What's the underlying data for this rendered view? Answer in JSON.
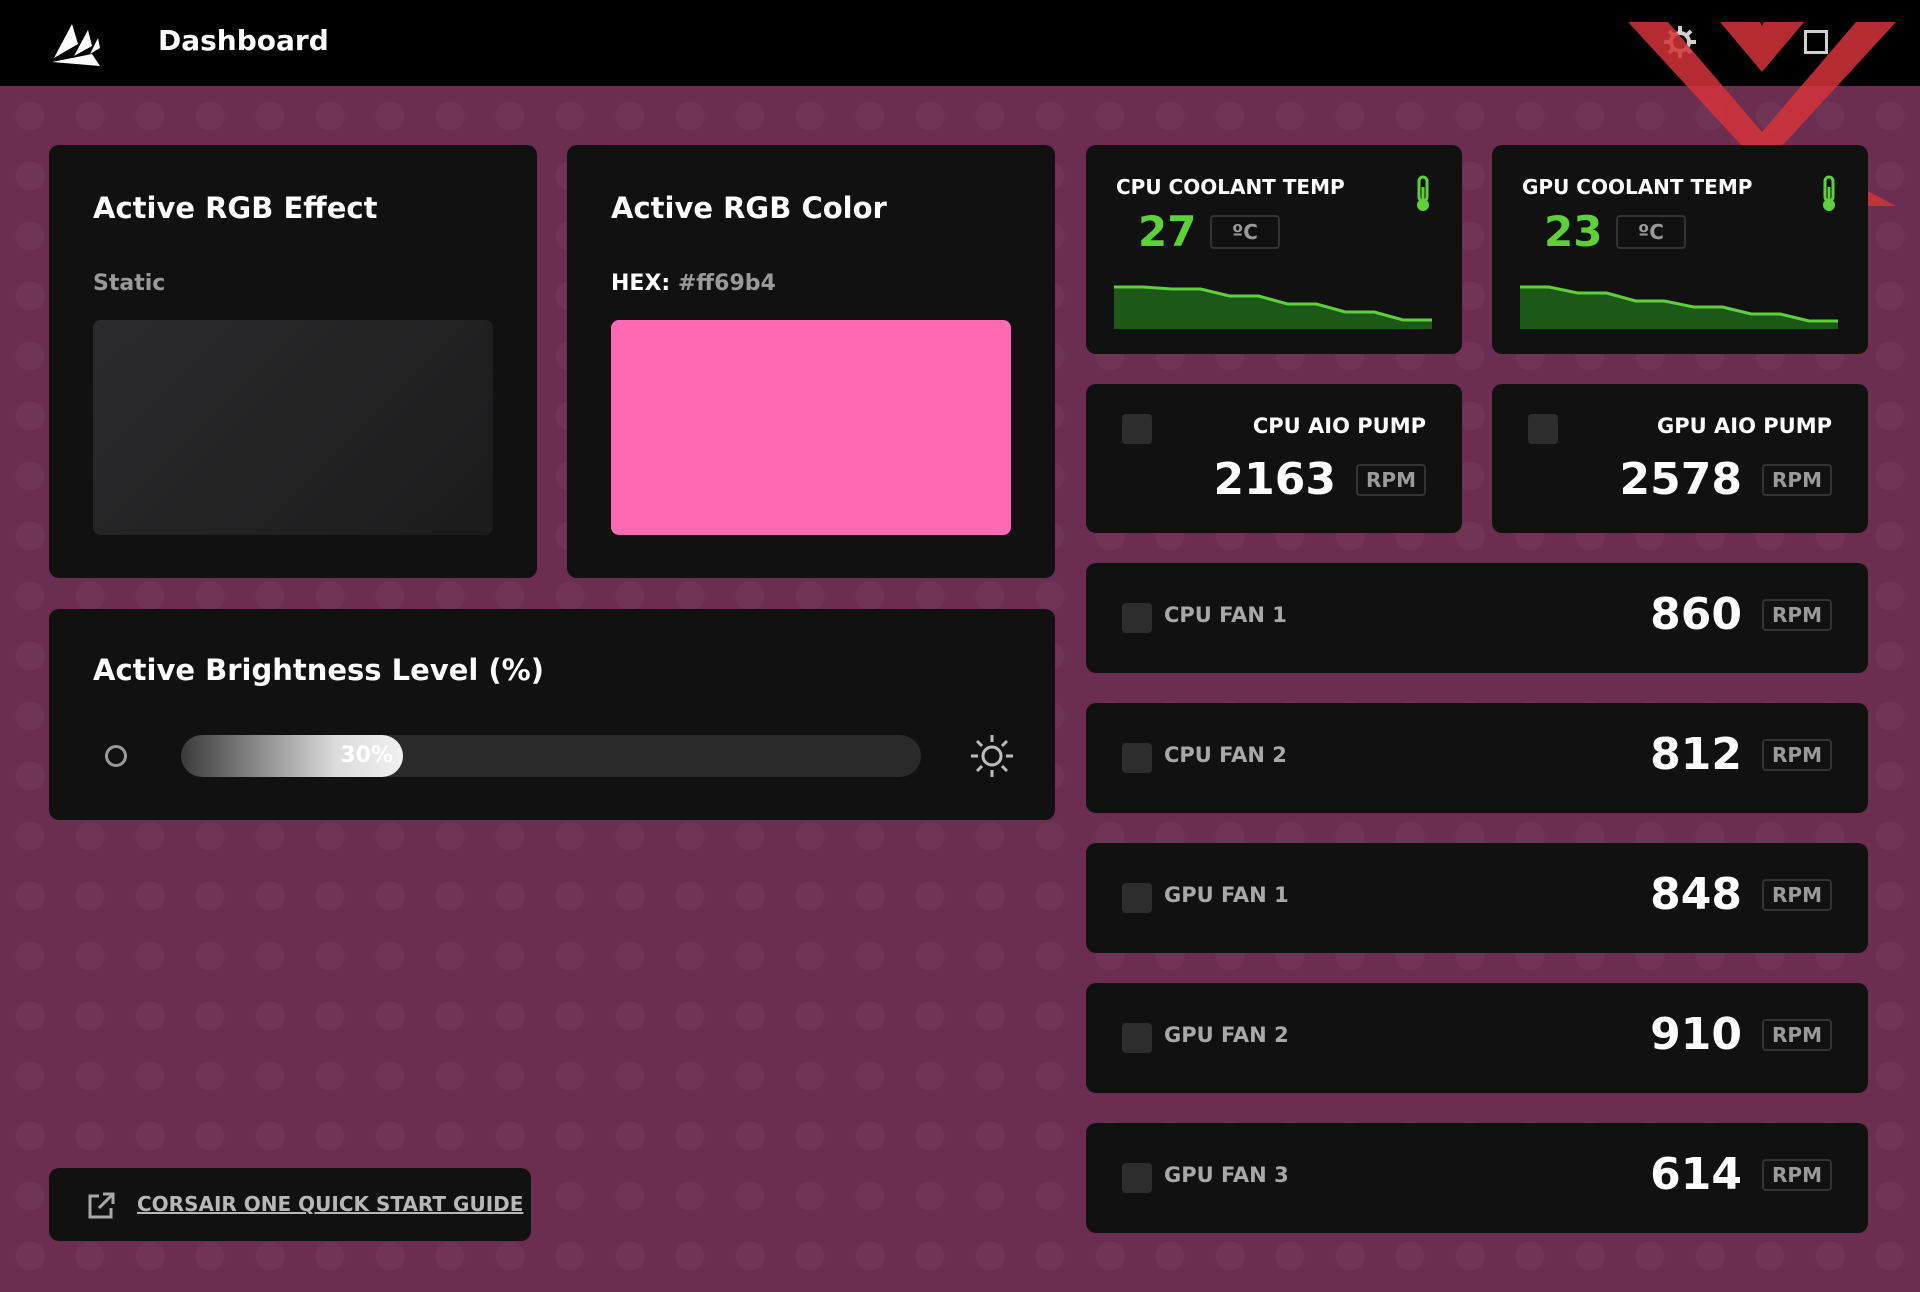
{
  "window": {
    "title": "Dashboard",
    "logo": "corsair-sails-logo",
    "icons": [
      "gear-icon",
      "maximize-icon"
    ]
  },
  "rgb_effect": {
    "title": "Active RGB Effect",
    "value": "Static"
  },
  "rgb_color": {
    "title": "Active RGB Color",
    "hex_label": "HEX:",
    "hex_value": "#ff69b4",
    "swatch": "#ff69b4"
  },
  "brightness": {
    "title": "Active Brightness Level (%)",
    "value_label": "30%",
    "fraction": 0.3
  },
  "quick_start": {
    "label": "CORSAIR ONE QUICK START GUIDE"
  },
  "temps": [
    {
      "label": "CPU COOLANT TEMP",
      "value": "27",
      "unit": "ºC",
      "trend": [
        42,
        42,
        40,
        40,
        33,
        33,
        25,
        25,
        17,
        17,
        9,
        9
      ]
    },
    {
      "label": "GPU COOLANT TEMP",
      "value": "23",
      "unit": "ºC",
      "trend": [
        42,
        42,
        36,
        36,
        28,
        28,
        22,
        22,
        15,
        15,
        8,
        8
      ]
    }
  ],
  "pumps": [
    {
      "label": "CPU AIO PUMP",
      "value": "2163",
      "unit": "RPM"
    },
    {
      "label": "GPU AIO PUMP",
      "value": "2578",
      "unit": "RPM"
    }
  ],
  "fans": [
    {
      "label": "CPU FAN 1",
      "value": "860",
      "unit": "RPM"
    },
    {
      "label": "CPU FAN 2",
      "value": "812",
      "unit": "RPM"
    },
    {
      "label": "GPU FAN 1",
      "value": "848",
      "unit": "RPM"
    },
    {
      "label": "GPU FAN 2",
      "value": "910",
      "unit": "RPM"
    },
    {
      "label": "GPU FAN 3",
      "value": "614",
      "unit": "RPM"
    }
  ],
  "colors": {
    "background": "#6b2d50",
    "card": "#111111",
    "temp_green": "#5dd03a",
    "accent_pink": "#ff69b4",
    "watermark_red": "#d6333b"
  }
}
